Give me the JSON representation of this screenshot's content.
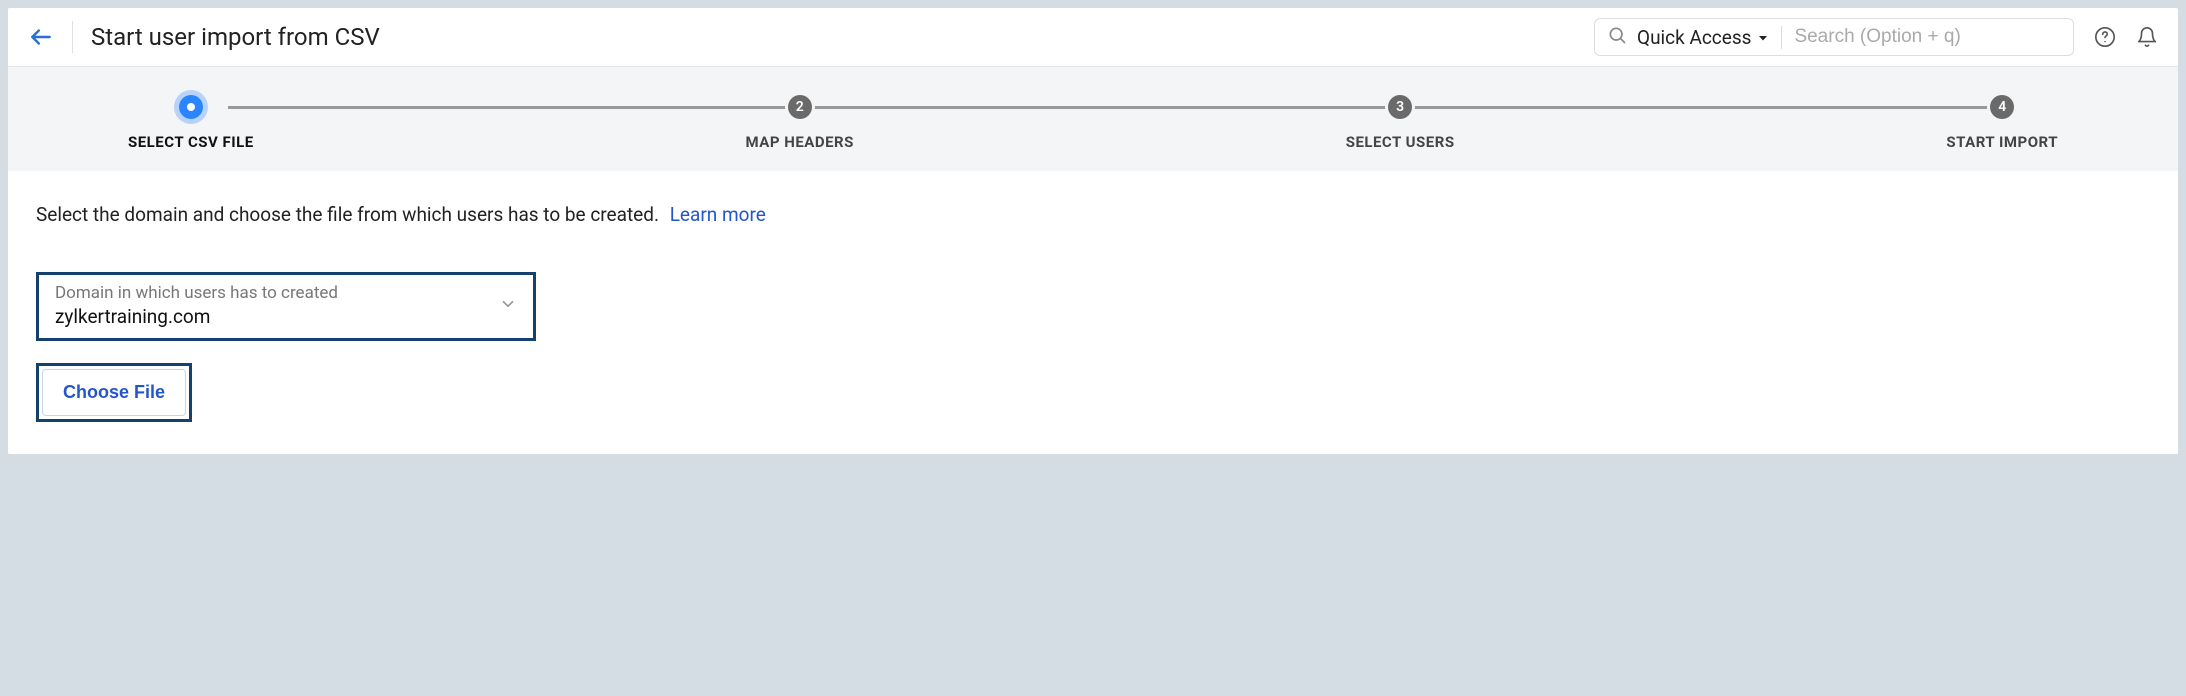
{
  "header": {
    "title": "Start user import from CSV",
    "quick_access_label": "Quick Access",
    "search_placeholder": "Search (Option + q)"
  },
  "stepper": {
    "steps": [
      {
        "num": "",
        "label": "SELECT CSV FILE",
        "active": true
      },
      {
        "num": "2",
        "label": "MAP HEADERS",
        "active": false
      },
      {
        "num": "3",
        "label": "SELECT USERS",
        "active": false
      },
      {
        "num": "4",
        "label": "START IMPORT",
        "active": false
      }
    ]
  },
  "content": {
    "instruction": "Select the domain and choose the file from which users has to be created.",
    "learn_more": "Learn more",
    "domain_label": "Domain in which users has to created",
    "domain_value": "zylkertraining.com",
    "choose_file": "Choose File"
  }
}
